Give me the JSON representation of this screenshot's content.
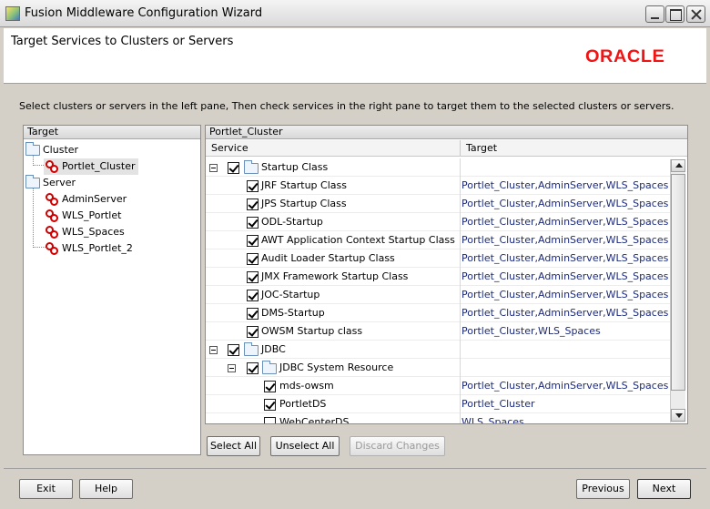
{
  "window": {
    "title": "Fusion Middleware Configuration Wizard"
  },
  "header": {
    "title": "Target Services to Clusters or Servers",
    "logo": "ORACLE"
  },
  "instruction": "Select clusters or servers in the left pane, Then check services in the right pane to target them to the selected clusters or servers.",
  "left_pane": {
    "header": "Target",
    "cluster_group": "Cluster",
    "cluster_items": [
      "Portlet_Cluster"
    ],
    "server_group": "Server",
    "server_items": [
      "AdminServer",
      "WLS_Portlet",
      "WLS_Spaces",
      "WLS_Portlet_2"
    ]
  },
  "right_pane": {
    "header": "Portlet_Cluster",
    "col_service": "Service",
    "col_target": "Target",
    "rows": [
      {
        "name": "Startup Class",
        "target": "",
        "checked": true
      },
      {
        "name": "JRF Startup Class",
        "target": "Portlet_Cluster,AdminServer,WLS_Spaces",
        "checked": true
      },
      {
        "name": "JPS Startup Class",
        "target": "Portlet_Cluster,AdminServer,WLS_Spaces",
        "checked": true
      },
      {
        "name": "ODL-Startup",
        "target": "Portlet_Cluster,AdminServer,WLS_Spaces",
        "checked": true
      },
      {
        "name": "AWT Application Context Startup Class",
        "target": "Portlet_Cluster,AdminServer,WLS_Spaces",
        "checked": true
      },
      {
        "name": "Audit Loader Startup Class",
        "target": "Portlet_Cluster,AdminServer,WLS_Spaces",
        "checked": true
      },
      {
        "name": "JMX Framework Startup Class",
        "target": "Portlet_Cluster,AdminServer,WLS_Spaces",
        "checked": true
      },
      {
        "name": "JOC-Startup",
        "target": "Portlet_Cluster,AdminServer,WLS_Spaces",
        "checked": true
      },
      {
        "name": "DMS-Startup",
        "target": "Portlet_Cluster,AdminServer,WLS_Spaces",
        "checked": true
      },
      {
        "name": "OWSM Startup class",
        "target": "Portlet_Cluster,WLS_Spaces",
        "checked": true
      },
      {
        "name": "JDBC",
        "target": "",
        "checked": true
      },
      {
        "name": "JDBC System Resource",
        "target": "",
        "checked": true
      },
      {
        "name": "mds-owsm",
        "target": "Portlet_Cluster,AdminServer,WLS_Spaces",
        "checked": true
      },
      {
        "name": "PortletDS",
        "target": "Portlet_Cluster",
        "checked": true
      },
      {
        "name": "WebCenterDS",
        "target": "WLS_Spaces",
        "checked": false
      }
    ]
  },
  "actions": {
    "select_all": "Select All",
    "unselect_all": "Unselect All",
    "discard": "Discard Changes"
  },
  "footer": {
    "exit": "Exit",
    "help": "Help",
    "previous": "Previous",
    "next": "Next"
  },
  "colors": {
    "oracle_red": "#f01414",
    "target_text": "#1b2a7a"
  }
}
